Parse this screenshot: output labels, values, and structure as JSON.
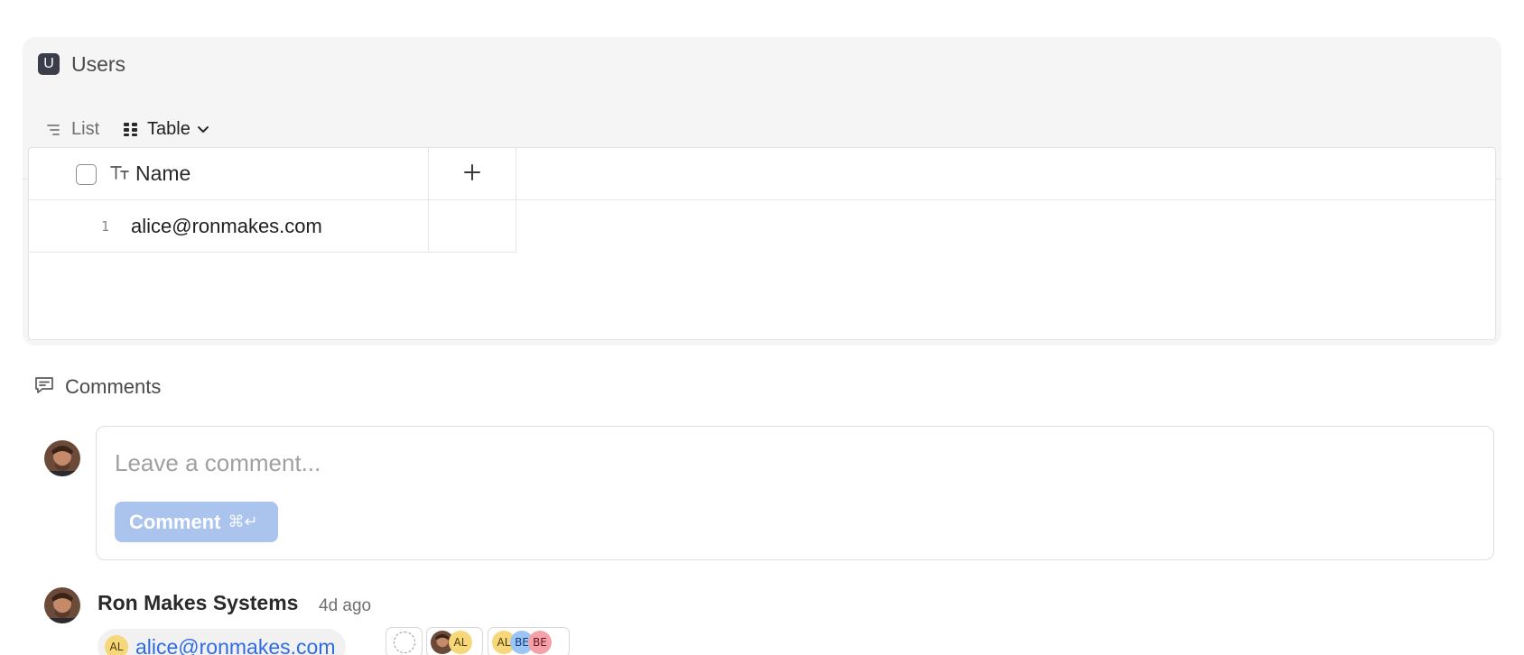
{
  "database": {
    "icon_letter": "U",
    "title": "Users",
    "views": [
      {
        "label": "List",
        "icon": "list-icon",
        "active": false
      },
      {
        "label": "Table",
        "icon": "grid-icon",
        "active": true
      }
    ],
    "table": {
      "columns": [
        {
          "label": "Name",
          "type_icon": "text-type-icon"
        }
      ],
      "rows": [
        {
          "index": "1",
          "name": "alice@ronmakes.com"
        }
      ]
    }
  },
  "comments": {
    "header": "Comments",
    "input_placeholder": "Leave a comment...",
    "submit_label": "Comment",
    "submit_shortcut": "⌘↵",
    "items": [
      {
        "author": "Ron Makes Systems",
        "time": "4d ago",
        "mention_initials": "AL",
        "mention_text": "alice@ronmakes.com",
        "reaction_initials_1": "AL",
        "reaction_initials_2": [
          "AL",
          "BE",
          "BE"
        ]
      }
    ]
  },
  "colors": {
    "accent": "#2e6be6",
    "button_disabled": "#abc4ee",
    "db_icon_bg": "#3b3d4a"
  }
}
